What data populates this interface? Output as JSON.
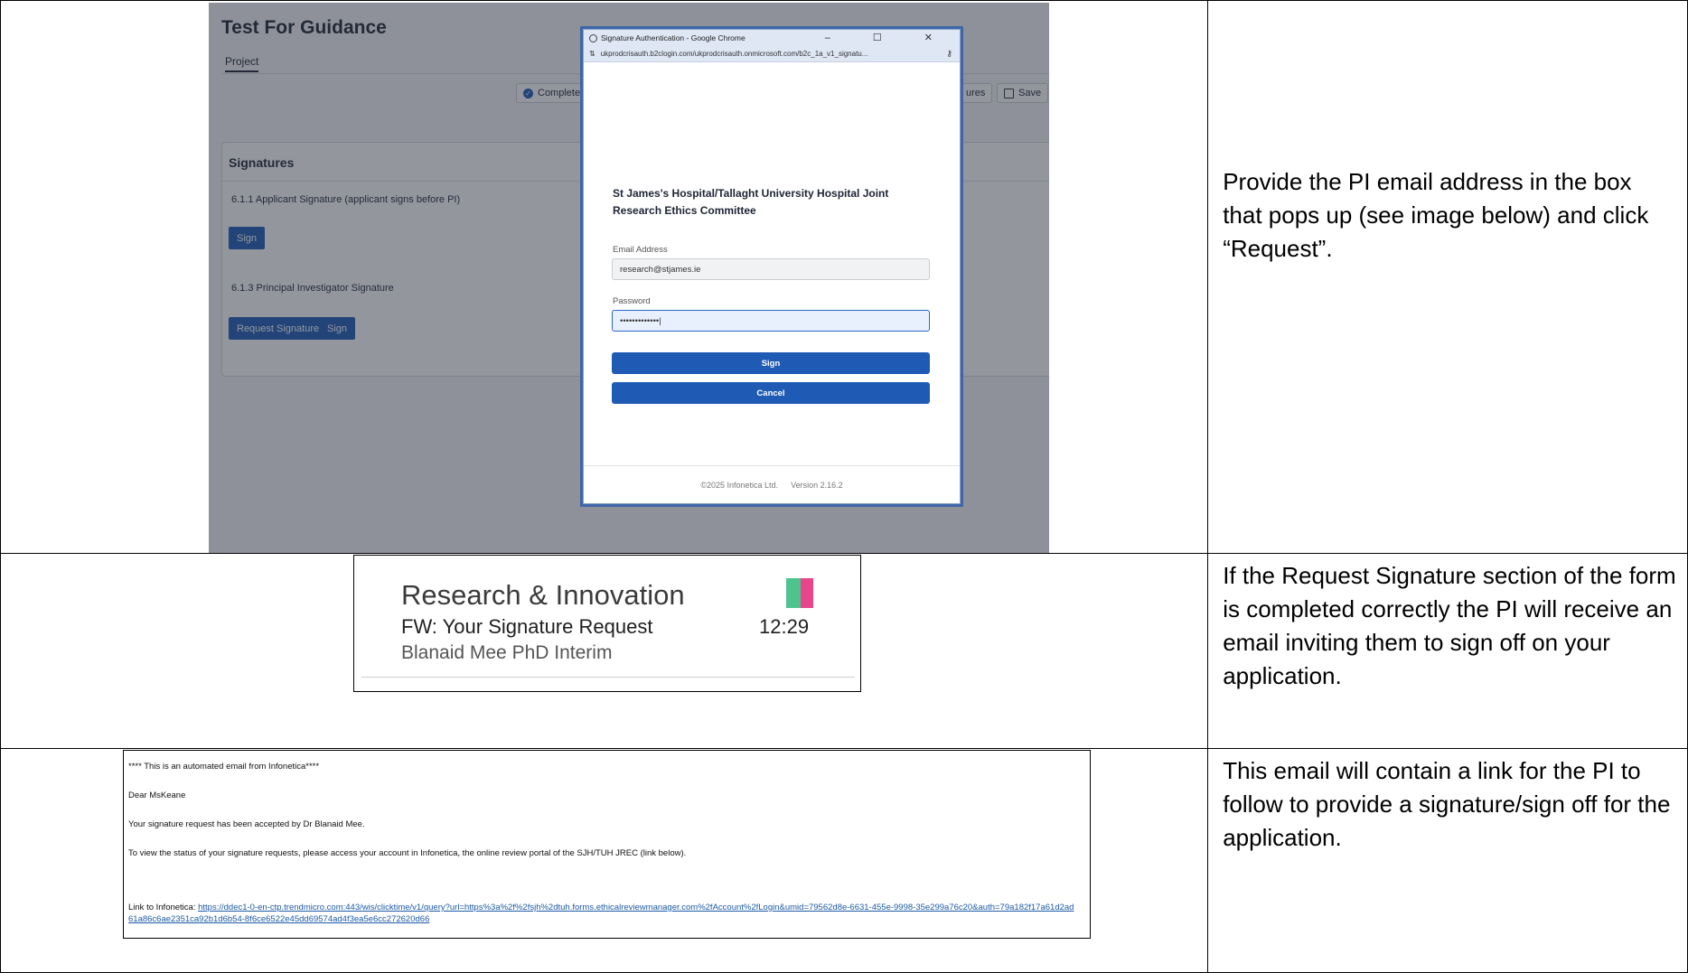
{
  "rows": [
    {
      "instruction": "Provide the PI email address in the box that pops up (see image below) and click “Request”."
    },
    {
      "instruction": "If the Request Signature section of the form is completed correctly the PI will receive an email inviting them to sign off on your application."
    },
    {
      "instruction": "This email will contain a link for the PI to follow to provide a signature/sign off for the application."
    }
  ],
  "screenshot1": {
    "app_title": "Test For Guidance",
    "tab_project": "Project",
    "toolbar": {
      "complete_label": "Complete",
      "signatures_label": "ures",
      "save_label": "Save"
    },
    "signatures": {
      "heading": "Signatures",
      "applicant_label": "6.1.1  Applicant Signature (applicant signs before PI)",
      "applicant_sign_button": "Sign",
      "pi_label": "6.1.3  Principal Investigator Signature",
      "request_signature_button": "Request Signature",
      "pi_sign_button": "Sign"
    },
    "popup": {
      "window_title": "Signature Authentication - Google Chrome",
      "window_controls": "–  ☐  ✕",
      "url": "ukprodcrisauth.b2clogin.com/ukprodcrisauth.onmicrosoft.com/b2c_1a_v1_signatu...",
      "organisation": "St James's Hospital/Tallaght University Hospital Joint Research Ethics Committee",
      "email_label": "Email Address",
      "email_value": "research@stjames.ie",
      "password_label": "Password",
      "password_value": "•••••••••••••|",
      "sign_button": "Sign",
      "cancel_button": "Cancel",
      "footer_copyright": "©2025 Infonetica Ltd.",
      "footer_version": "Version 2.16.2"
    }
  },
  "screenshot2": {
    "sender": "Research & Innovation",
    "subject": "FW: Your Signature Request",
    "time": "12:29",
    "preview": "Blanaid Mee PhD  Interim",
    "flag_colors": [
      "#4fc38d",
      "#e8458b"
    ]
  },
  "screenshot3": {
    "banner": "**** This is an automated email from Infonetica****",
    "greeting": "Dear MsKeane",
    "accepted": "Your signature request has been accepted by Dr Blanaid Mee.",
    "status": "To view the status of your signature requests, please access your account in Infonetica, the online review portal of the SJH/TUH JREC (link below).",
    "link_label": "Link to Infonetica: ",
    "link_url": "https://ddec1-0-en-ctp.trendmicro.com:443/wis/clicktime/v1/query?url=https%3a%2f%2fsjh%2dtuh.forms.ethicalreviewmanager.com%2fAccount%2fLogin&umid=79562d8e-6631-455e-9998-35e299a76c20&auth=79a182f17a61d2ad61a86c6ae2351ca92b1d6b54-8f6ce6522e45dd69574ad4f3ea5e6cc272620d66"
  }
}
